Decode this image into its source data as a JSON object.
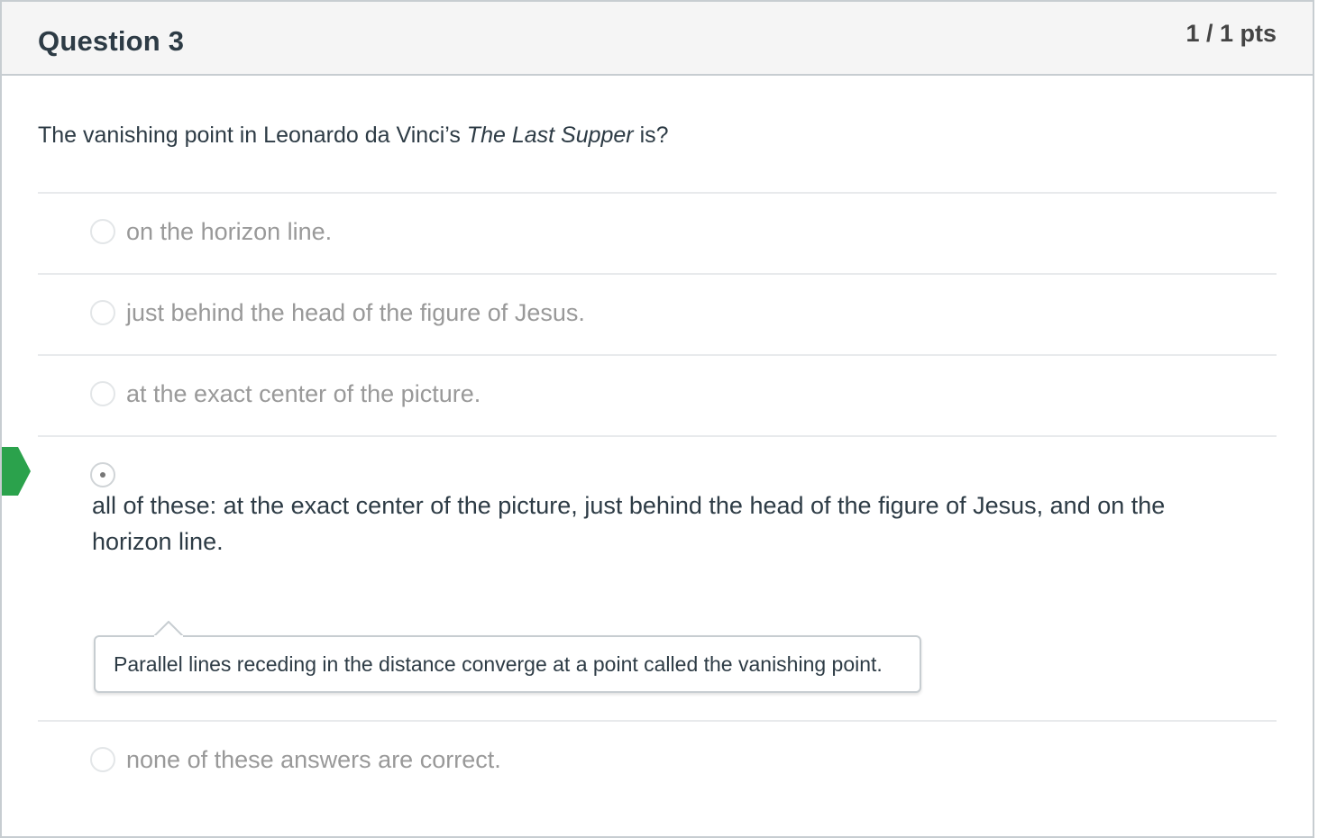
{
  "question": {
    "title": "Question 3",
    "points": "1 / 1 pts",
    "text_before": "The vanishing point in Leonardo da Vinci’s ",
    "text_italic": "The Last Supper",
    "text_after": " is?"
  },
  "answers": [
    {
      "label": "on the horizon line.",
      "selected": false
    },
    {
      "label": "just behind the head of the figure of Jesus.",
      "selected": false
    },
    {
      "label": "at the exact center of the picture.",
      "selected": false
    },
    {
      "label": "all of these: at the exact center of the picture, just behind the head of the figure of Jesus, and on the horizon line.",
      "selected": true,
      "correct": true
    },
    {
      "label": "none of these answers are correct.",
      "selected": false
    }
  ],
  "feedback": {
    "text": "Parallel lines receding in the distance converge at a point called the vanishing point."
  },
  "colors": {
    "correct_marker": "#2ba24c",
    "header_bg": "#f5f5f5",
    "unselected_text": "#999999",
    "selected_text": "#2d3b45"
  },
  "icons": {
    "correct_marker": "correct-answer-arrow-icon",
    "radio": "radio-button-icon"
  }
}
